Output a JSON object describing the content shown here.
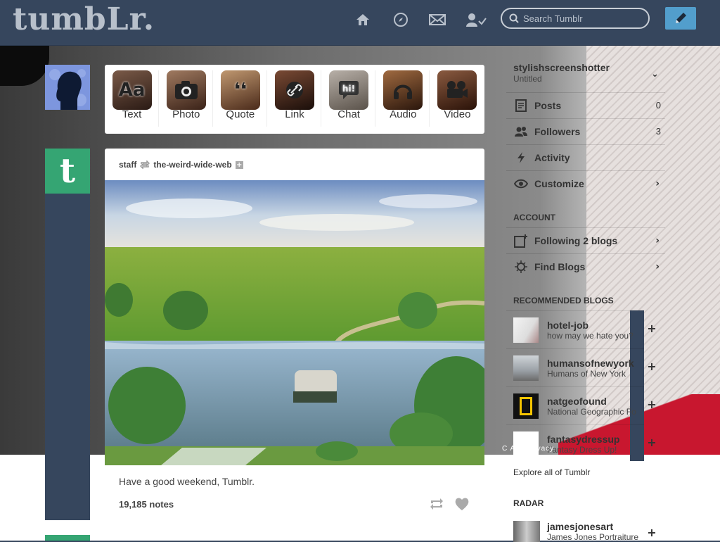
{
  "header": {
    "logo": "tumbLr.",
    "nav": [
      {
        "name": "home-icon"
      },
      {
        "name": "explore-compass-icon"
      },
      {
        "name": "inbox-envelope-icon"
      },
      {
        "name": "account-person-icon"
      }
    ],
    "search_placeholder": "Search Tumblr",
    "compose_icon": "pencil-icon"
  },
  "post_types": [
    {
      "label": "Text",
      "glyph": "Aa"
    },
    {
      "label": "Photo",
      "glyph": "camera-icon"
    },
    {
      "label": "Quote",
      "glyph": "❛❛"
    },
    {
      "label": "Link",
      "glyph": "link-icon"
    },
    {
      "label": "Chat",
      "glyph": "hi!"
    },
    {
      "label": "Audio",
      "glyph": "headphones-icon"
    },
    {
      "label": "Video",
      "glyph": "video-camera-icon"
    }
  ],
  "post": {
    "author": "staff",
    "reblogged_from": "the-weird-wide-web",
    "caption": "Have a good weekend, Tumblr.",
    "notes": "19,185 notes"
  },
  "sidebar": {
    "blog_name": "stylishscreenshotter",
    "blog_subtitle": "Untitled",
    "rows": [
      {
        "label": "Posts",
        "count": "0",
        "icon": "posts-icon"
      },
      {
        "label": "Followers",
        "count": "3",
        "icon": "followers-icon"
      },
      {
        "label": "Activity",
        "count": "",
        "icon": "activity-bolt-icon"
      },
      {
        "label": "Customize",
        "count": "",
        "icon": "eye-icon"
      }
    ],
    "account_heading": "ACCOUNT",
    "account_rows": [
      {
        "label": "Following 2 blogs",
        "icon": "following-icon"
      },
      {
        "label": "Find Blogs",
        "icon": "find-blogs-icon"
      }
    ],
    "recommended_heading": "RECOMMENDED BLOGS",
    "recommended": [
      {
        "name": "hotel-job",
        "desc": "how may we hate you?"
      },
      {
        "name": "humansofnewyork",
        "desc": "Humans of New York"
      },
      {
        "name": "natgeofound",
        "desc": "National Geographic Fo"
      },
      {
        "name": "fantasydressup",
        "desc": "Fantasy Dress Up!"
      }
    ],
    "explore": "Explore all of Tumblr",
    "radar_heading": "RADAR",
    "radar": {
      "name": "jamesjonesart",
      "desc": "James Jones Portraiture"
    },
    "footer_bits": "C A      N      Privacy"
  },
  "colors": {
    "header_bg": "#36465d",
    "compose_bg": "#529ecc",
    "staff_green": "#35a573"
  }
}
